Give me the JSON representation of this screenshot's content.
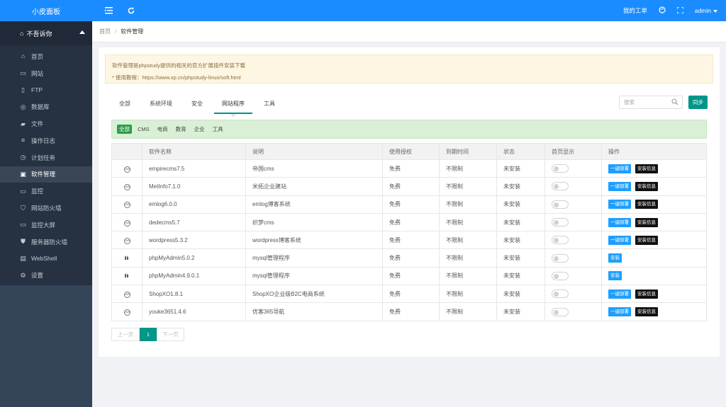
{
  "app": {
    "logo": "小皮面板"
  },
  "sidebar": {
    "user": "不吾诉你",
    "items": [
      {
        "label": "首页",
        "icon": "home-icon",
        "glyph": "⌂",
        "active": false
      },
      {
        "label": "网站",
        "icon": "monitor-icon",
        "glyph": "▭",
        "active": false
      },
      {
        "label": "FTP",
        "icon": "file-icon",
        "glyph": "▯",
        "active": false
      },
      {
        "label": "数据库",
        "icon": "database-icon",
        "glyph": "◎",
        "active": false
      },
      {
        "label": "文件",
        "icon": "folder-icon",
        "glyph": "▰",
        "active": false
      },
      {
        "label": "操作日志",
        "icon": "log-icon",
        "glyph": "≡",
        "active": false
      },
      {
        "label": "计划任务",
        "icon": "clock-icon",
        "glyph": "◷",
        "active": false
      },
      {
        "label": "软件管理",
        "icon": "software-icon",
        "glyph": "▣",
        "active": true
      },
      {
        "label": "监控",
        "icon": "monitor-chart-icon",
        "glyph": "▭",
        "active": false
      },
      {
        "label": "网站防火墙",
        "icon": "shield-icon",
        "glyph": "⛉",
        "active": false
      },
      {
        "label": "监控大屏",
        "icon": "screen-icon",
        "glyph": "▭",
        "active": false
      },
      {
        "label": "服务器防火墙",
        "icon": "shield-solid-icon",
        "glyph": "⛊",
        "active": false
      },
      {
        "label": "WebShell",
        "icon": "terminal-icon",
        "glyph": "▤",
        "active": false
      },
      {
        "label": "设置",
        "icon": "gear-icon",
        "glyph": "⚙",
        "active": false
      }
    ]
  },
  "topbar": {
    "my_orders": "我的工单",
    "admin": "admin"
  },
  "breadcrumb": {
    "home": "首页",
    "current": "软件管理"
  },
  "notice": {
    "line1": "软件管理是phpstudy提供的相关的官方扩展插件安装下载",
    "line2": "* 使用教程：https://www.xp.cn/phpstudy-linux/soft.html"
  },
  "tabs": [
    "全部",
    "系统环境",
    "安全",
    "网站程序",
    "工具"
  ],
  "active_tab": 3,
  "search": {
    "placeholder": "搜索"
  },
  "sync_label": "同步",
  "filters": [
    "全部",
    "CMS",
    "电商",
    "教育",
    "企业",
    "工具"
  ],
  "table": {
    "headers": [
      "",
      "软件名称",
      "说明",
      "使用授权",
      "到期时间",
      "状态",
      "首页显示",
      "操作"
    ],
    "deploy_label": "一键部署",
    "info_label": "安装信息",
    "install_label": "安装",
    "rows": [
      {
        "icon": "cms",
        "name": "empirecms7.5",
        "desc": "帝国cms",
        "license": "免费",
        "expire": "不限制",
        "status": "未安装",
        "mode": "deploy"
      },
      {
        "icon": "cms",
        "name": "MetInfo7.1.0",
        "desc": "米拓企业建站",
        "license": "免费",
        "expire": "不限制",
        "status": "未安装",
        "mode": "deploy"
      },
      {
        "icon": "cms",
        "name": "emlog6.0.0",
        "desc": "emlog博客系统",
        "license": "免费",
        "expire": "不限制",
        "status": "未安装",
        "mode": "deploy"
      },
      {
        "icon": "cms",
        "name": "dedecms5.7",
        "desc": "织梦cms",
        "license": "免费",
        "expire": "不限制",
        "status": "未安装",
        "mode": "deploy"
      },
      {
        "icon": "cms",
        "name": "wordpress5.3.2",
        "desc": "wordpress博客系统",
        "license": "免费",
        "expire": "不限制",
        "status": "未安装",
        "mode": "deploy"
      },
      {
        "icon": "db",
        "name": "phpMyAdmin5.0.2",
        "desc": "mysql管理程序",
        "license": "免费",
        "expire": "不限制",
        "status": "未安装",
        "mode": "install"
      },
      {
        "icon": "db",
        "name": "phpMyAdmin4.9.0.1",
        "desc": "mysql管理程序",
        "license": "免费",
        "expire": "不限制",
        "status": "未安装",
        "mode": "install"
      },
      {
        "icon": "cms",
        "name": "ShopXO1.8.1",
        "desc": "ShopXO企业级B2C电商系统",
        "license": "免费",
        "expire": "不限制",
        "status": "未安装",
        "mode": "deploy"
      },
      {
        "icon": "cms",
        "name": "youke3651.4.6",
        "desc": "优客365导航",
        "license": "免费",
        "expire": "不限制",
        "status": "未安装",
        "mode": "deploy"
      }
    ]
  },
  "pager": {
    "prev": "上一页",
    "current": "1",
    "next": "下一页"
  },
  "colors": {
    "primary": "#1a8cff",
    "sidebar": "#263241",
    "accent": "#009688",
    "filter_bg": "#d9efd6"
  }
}
